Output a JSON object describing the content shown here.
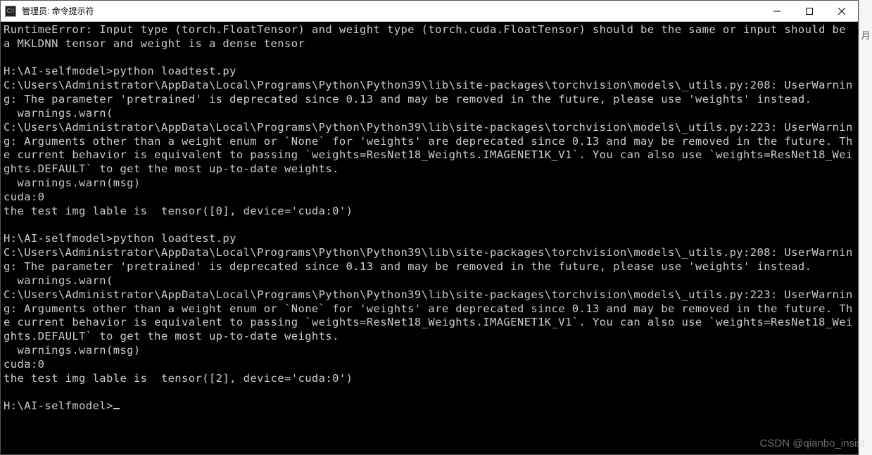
{
  "window": {
    "icon_label": "C:\\",
    "title": "管理员: 命令提示符"
  },
  "terminal": {
    "lines": [
      "RuntimeError: Input type (torch.FloatTensor) and weight type (torch.cuda.FloatTensor) should be the same or input should be a MKLDNN tensor and weight is a dense tensor",
      "",
      "H:\\AI-selfmodel>python loadtest.py",
      "C:\\Users\\Administrator\\AppData\\Local\\Programs\\Python\\Python39\\lib\\site-packages\\torchvision\\models\\_utils.py:208: UserWarning: The parameter 'pretrained' is deprecated since 0.13 and may be removed in the future, please use 'weights' instead.",
      "  warnings.warn(",
      "C:\\Users\\Administrator\\AppData\\Local\\Programs\\Python\\Python39\\lib\\site-packages\\torchvision\\models\\_utils.py:223: UserWarning: Arguments other than a weight enum or `None` for 'weights' are deprecated since 0.13 and may be removed in the future. The current behavior is equivalent to passing `weights=ResNet18_Weights.IMAGENET1K_V1`. You can also use `weights=ResNet18_Weights.DEFAULT` to get the most up-to-date weights.",
      "  warnings.warn(msg)",
      "cuda:0",
      "the test img lable is  tensor([0], device='cuda:0')",
      "",
      "H:\\AI-selfmodel>python loadtest.py",
      "C:\\Users\\Administrator\\AppData\\Local\\Programs\\Python\\Python39\\lib\\site-packages\\torchvision\\models\\_utils.py:208: UserWarning: The parameter 'pretrained' is deprecated since 0.13 and may be removed in the future, please use 'weights' instead.",
      "  warnings.warn(",
      "C:\\Users\\Administrator\\AppData\\Local\\Programs\\Python\\Python39\\lib\\site-packages\\torchvision\\models\\_utils.py:223: UserWarning: Arguments other than a weight enum or `None` for 'weights' are deprecated since 0.13 and may be removed in the future. The current behavior is equivalent to passing `weights=ResNet18_Weights.IMAGENET1K_V1`. You can also use `weights=ResNet18_Weights.DEFAULT` to get the most up-to-date weights.",
      "  warnings.warn(msg)",
      "cuda:0",
      "the test img lable is  tensor([2], device='cuda:0')",
      "",
      "H:\\AI-selfmodel>"
    ]
  },
  "watermark": "CSDN @qianbo_insist",
  "right_strip": "月"
}
